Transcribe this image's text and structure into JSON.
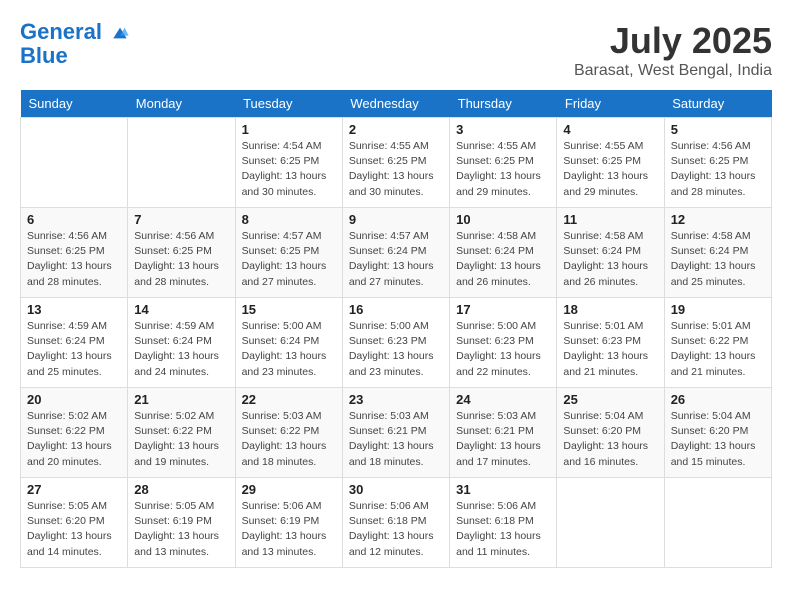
{
  "header": {
    "logo_line1": "General",
    "logo_line2": "Blue",
    "month": "July 2025",
    "location": "Barasat, West Bengal, India"
  },
  "weekdays": [
    "Sunday",
    "Monday",
    "Tuesday",
    "Wednesday",
    "Thursday",
    "Friday",
    "Saturday"
  ],
  "weeks": [
    [
      {
        "day": "",
        "info": ""
      },
      {
        "day": "",
        "info": ""
      },
      {
        "day": "1",
        "info": "Sunrise: 4:54 AM\nSunset: 6:25 PM\nDaylight: 13 hours\nand 30 minutes."
      },
      {
        "day": "2",
        "info": "Sunrise: 4:55 AM\nSunset: 6:25 PM\nDaylight: 13 hours\nand 30 minutes."
      },
      {
        "day": "3",
        "info": "Sunrise: 4:55 AM\nSunset: 6:25 PM\nDaylight: 13 hours\nand 29 minutes."
      },
      {
        "day": "4",
        "info": "Sunrise: 4:55 AM\nSunset: 6:25 PM\nDaylight: 13 hours\nand 29 minutes."
      },
      {
        "day": "5",
        "info": "Sunrise: 4:56 AM\nSunset: 6:25 PM\nDaylight: 13 hours\nand 28 minutes."
      }
    ],
    [
      {
        "day": "6",
        "info": "Sunrise: 4:56 AM\nSunset: 6:25 PM\nDaylight: 13 hours\nand 28 minutes."
      },
      {
        "day": "7",
        "info": "Sunrise: 4:56 AM\nSunset: 6:25 PM\nDaylight: 13 hours\nand 28 minutes."
      },
      {
        "day": "8",
        "info": "Sunrise: 4:57 AM\nSunset: 6:25 PM\nDaylight: 13 hours\nand 27 minutes."
      },
      {
        "day": "9",
        "info": "Sunrise: 4:57 AM\nSunset: 6:24 PM\nDaylight: 13 hours\nand 27 minutes."
      },
      {
        "day": "10",
        "info": "Sunrise: 4:58 AM\nSunset: 6:24 PM\nDaylight: 13 hours\nand 26 minutes."
      },
      {
        "day": "11",
        "info": "Sunrise: 4:58 AM\nSunset: 6:24 PM\nDaylight: 13 hours\nand 26 minutes."
      },
      {
        "day": "12",
        "info": "Sunrise: 4:58 AM\nSunset: 6:24 PM\nDaylight: 13 hours\nand 25 minutes."
      }
    ],
    [
      {
        "day": "13",
        "info": "Sunrise: 4:59 AM\nSunset: 6:24 PM\nDaylight: 13 hours\nand 25 minutes."
      },
      {
        "day": "14",
        "info": "Sunrise: 4:59 AM\nSunset: 6:24 PM\nDaylight: 13 hours\nand 24 minutes."
      },
      {
        "day": "15",
        "info": "Sunrise: 5:00 AM\nSunset: 6:24 PM\nDaylight: 13 hours\nand 23 minutes."
      },
      {
        "day": "16",
        "info": "Sunrise: 5:00 AM\nSunset: 6:23 PM\nDaylight: 13 hours\nand 23 minutes."
      },
      {
        "day": "17",
        "info": "Sunrise: 5:00 AM\nSunset: 6:23 PM\nDaylight: 13 hours\nand 22 minutes."
      },
      {
        "day": "18",
        "info": "Sunrise: 5:01 AM\nSunset: 6:23 PM\nDaylight: 13 hours\nand 21 minutes."
      },
      {
        "day": "19",
        "info": "Sunrise: 5:01 AM\nSunset: 6:22 PM\nDaylight: 13 hours\nand 21 minutes."
      }
    ],
    [
      {
        "day": "20",
        "info": "Sunrise: 5:02 AM\nSunset: 6:22 PM\nDaylight: 13 hours\nand 20 minutes."
      },
      {
        "day": "21",
        "info": "Sunrise: 5:02 AM\nSunset: 6:22 PM\nDaylight: 13 hours\nand 19 minutes."
      },
      {
        "day": "22",
        "info": "Sunrise: 5:03 AM\nSunset: 6:22 PM\nDaylight: 13 hours\nand 18 minutes."
      },
      {
        "day": "23",
        "info": "Sunrise: 5:03 AM\nSunset: 6:21 PM\nDaylight: 13 hours\nand 18 minutes."
      },
      {
        "day": "24",
        "info": "Sunrise: 5:03 AM\nSunset: 6:21 PM\nDaylight: 13 hours\nand 17 minutes."
      },
      {
        "day": "25",
        "info": "Sunrise: 5:04 AM\nSunset: 6:20 PM\nDaylight: 13 hours\nand 16 minutes."
      },
      {
        "day": "26",
        "info": "Sunrise: 5:04 AM\nSunset: 6:20 PM\nDaylight: 13 hours\nand 15 minutes."
      }
    ],
    [
      {
        "day": "27",
        "info": "Sunrise: 5:05 AM\nSunset: 6:20 PM\nDaylight: 13 hours\nand 14 minutes."
      },
      {
        "day": "28",
        "info": "Sunrise: 5:05 AM\nSunset: 6:19 PM\nDaylight: 13 hours\nand 13 minutes."
      },
      {
        "day": "29",
        "info": "Sunrise: 5:06 AM\nSunset: 6:19 PM\nDaylight: 13 hours\nand 13 minutes."
      },
      {
        "day": "30",
        "info": "Sunrise: 5:06 AM\nSunset: 6:18 PM\nDaylight: 13 hours\nand 12 minutes."
      },
      {
        "day": "31",
        "info": "Sunrise: 5:06 AM\nSunset: 6:18 PM\nDaylight: 13 hours\nand 11 minutes."
      },
      {
        "day": "",
        "info": ""
      },
      {
        "day": "",
        "info": ""
      }
    ]
  ]
}
